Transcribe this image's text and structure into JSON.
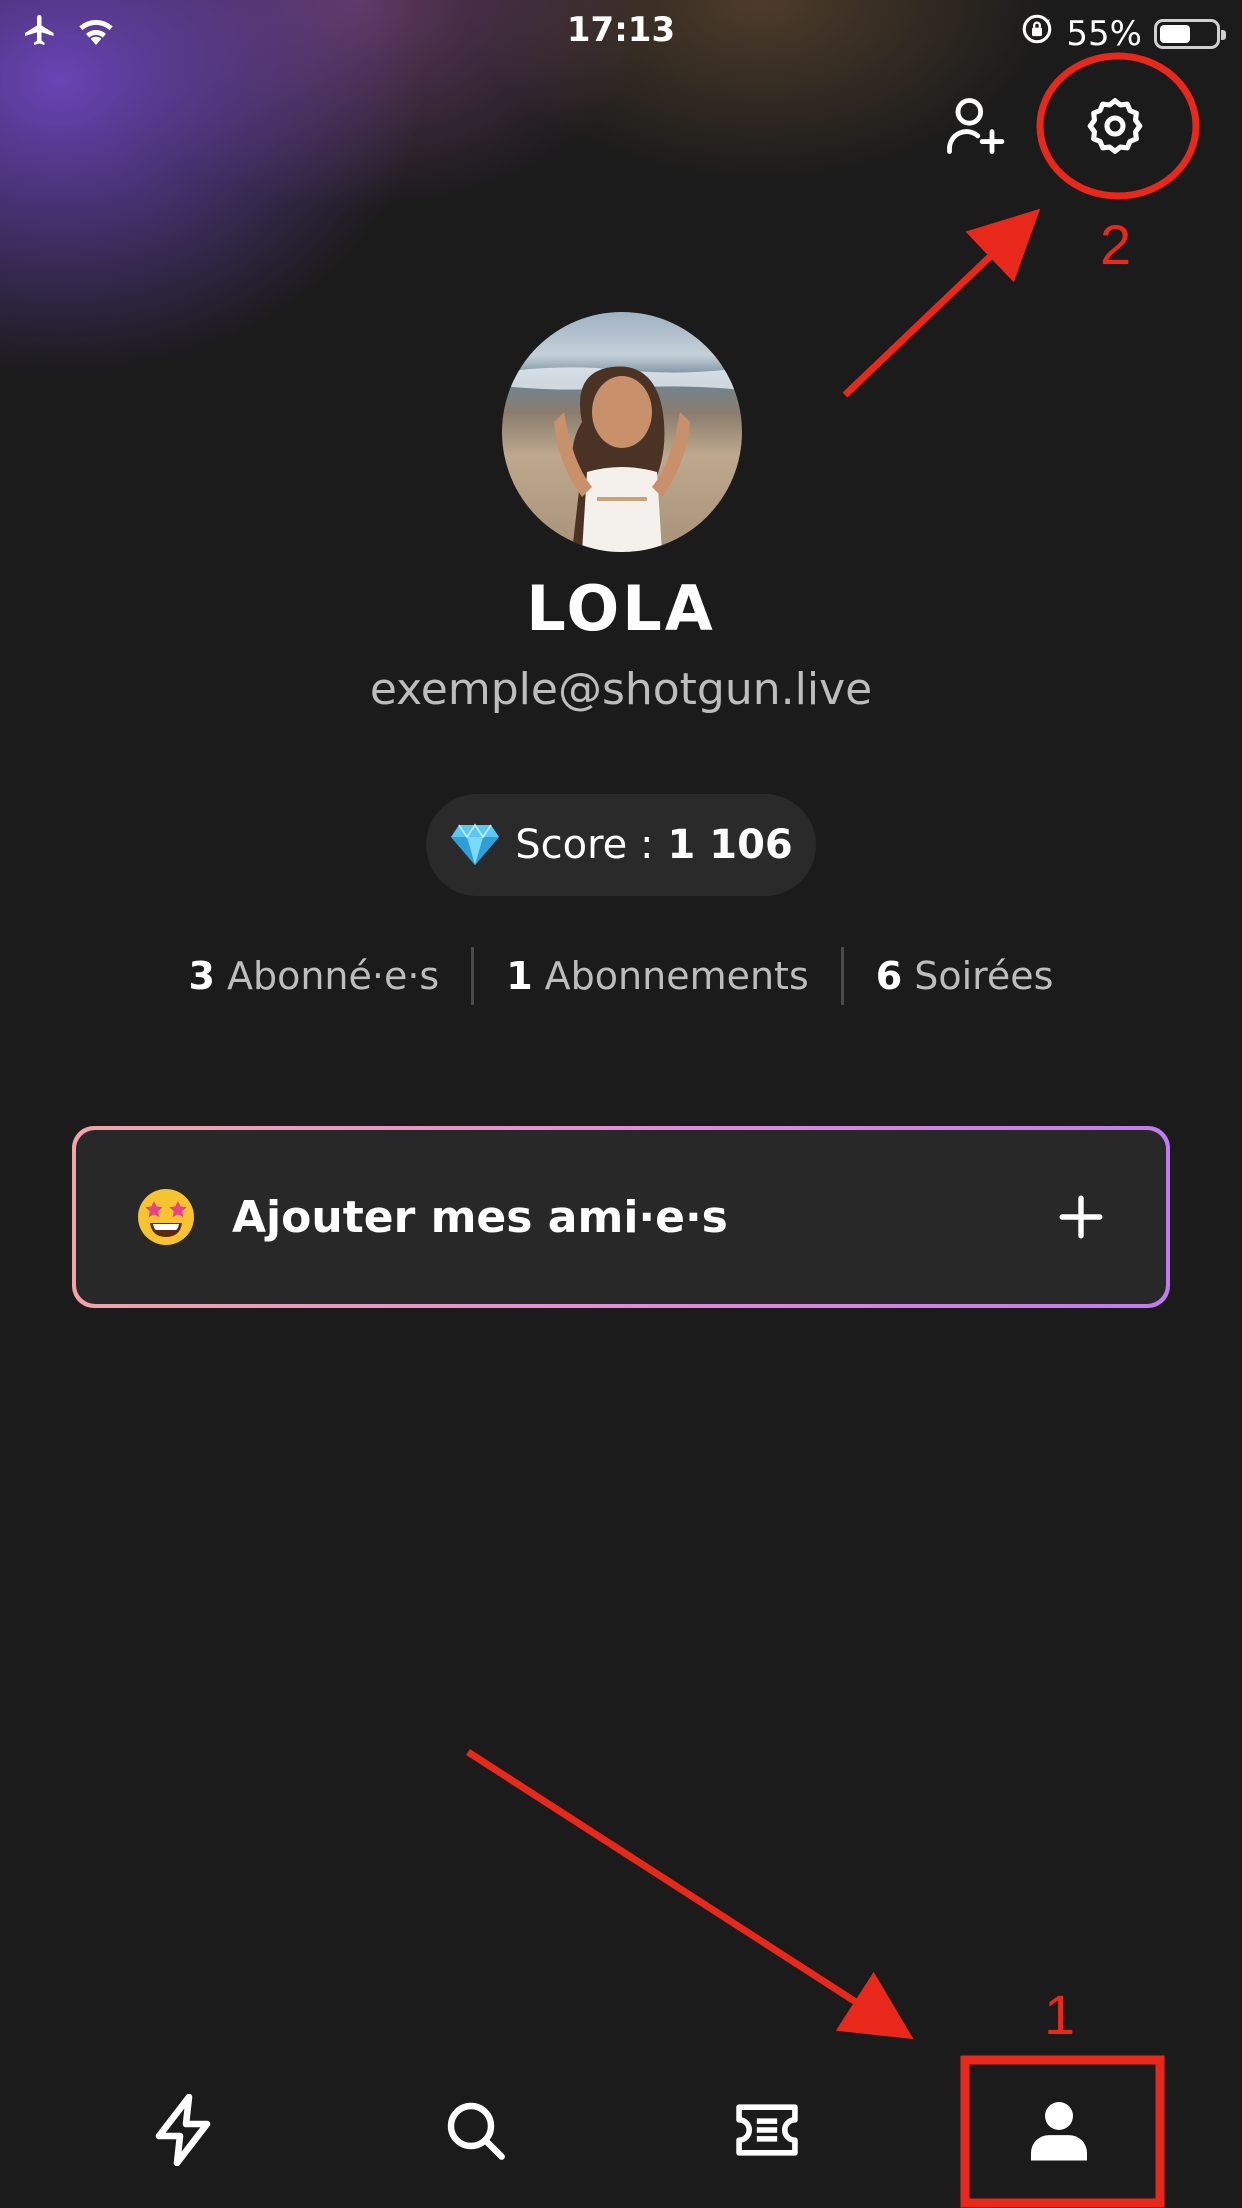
{
  "status_bar": {
    "time": "17:13",
    "battery_percent_text": "55%",
    "battery_level": 0.55,
    "icons": [
      "airplane-icon",
      "wifi-icon",
      "rotation-lock-icon",
      "battery-icon"
    ]
  },
  "header": {
    "icons": [
      "add-friend-icon",
      "settings-icon"
    ]
  },
  "profile": {
    "name": "LOLA",
    "email": "exemple@shotgun.live",
    "score_label": "Score :",
    "score_value": "1 106",
    "stats": [
      {
        "count": "3",
        "label": "Abonné·e·s"
      },
      {
        "count": "1",
        "label": "Abonnements"
      },
      {
        "count": "6",
        "label": "Soirées"
      }
    ]
  },
  "add_friends": {
    "label": "Ajouter mes ami·e·s",
    "icon": "plus-icon"
  },
  "tab_bar": {
    "tabs": [
      "feed-icon",
      "search-icon",
      "ticket-icon",
      "profile-icon"
    ],
    "active": "profile-icon"
  },
  "annotations": {
    "step_1": "1",
    "step_2": "2",
    "color": "#e8281b"
  }
}
